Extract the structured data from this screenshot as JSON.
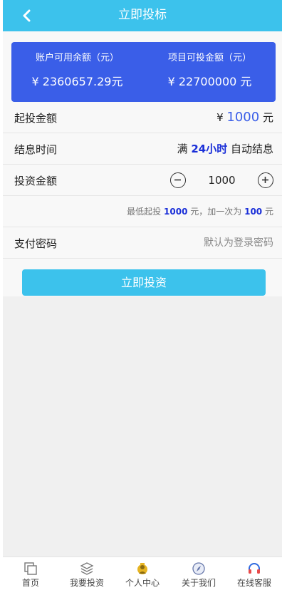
{
  "header": {
    "title": "立即投标"
  },
  "balance": {
    "account_label": "账户可用余额（元）",
    "account_value": "¥ 2360657.29元",
    "project_label": "项目可投金额（元）",
    "project_value": "¥ 22700000 元"
  },
  "start_amount": {
    "label": "起投金额",
    "currency": "¥",
    "value": "1000",
    "unit": "元"
  },
  "settle_time": {
    "label": "结息时间",
    "prefix": "满",
    "value": "24小时",
    "suffix": "自动结息"
  },
  "invest_amount": {
    "label": "投资金额",
    "value": "1000"
  },
  "hint": {
    "part1": "最低起投",
    "min": "1000",
    "part2": "元，加一次为",
    "step": "100",
    "part3": "元"
  },
  "pay_password": {
    "label": "支付密码",
    "placeholder": "默认为登录密码"
  },
  "submit_label": "立即投资",
  "tabs": [
    {
      "label": "首页",
      "icon": "home-icon"
    },
    {
      "label": "我要投资",
      "icon": "layers-icon"
    },
    {
      "label": "个人中心",
      "icon": "user-center-icon"
    },
    {
      "label": "关于我们",
      "icon": "compass-icon"
    },
    {
      "label": "在线客服",
      "icon": "headset-icon"
    }
  ],
  "colors": {
    "primary": "#3cc2ec",
    "card": "#3a5ee8",
    "highlight": "#1a2fd8"
  }
}
